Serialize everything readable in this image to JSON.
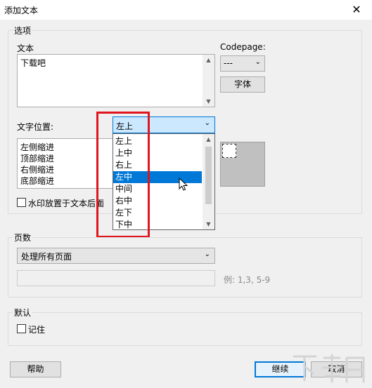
{
  "window": {
    "title": "添加文本"
  },
  "options_group": {
    "label": "选项",
    "text_label": "文本",
    "text_value": "下载吧",
    "codepage_label": "Codepage:",
    "codepage_value": "---",
    "font_button": "字体",
    "position_label": "文字位置:",
    "position_value": "左上",
    "position_options": [
      "左上",
      "上中",
      "右上",
      "左中",
      "中间",
      "右中",
      "左下",
      "下中"
    ],
    "position_highlighted": "左中",
    "indent_items": [
      "左侧缩进",
      "顶部缩进",
      "右侧缩进",
      "底部缩进"
    ],
    "watermark_behind_label": "水印放置于文本后面"
  },
  "pages_group": {
    "label": "页数",
    "mode_value": "处理所有页面",
    "range_hint": "例: 1,3, 5-9"
  },
  "default_group": {
    "label": "默认",
    "remember_label": "记住"
  },
  "buttons": {
    "help": "帮助",
    "continue": "继续",
    "cancel": "取消"
  },
  "colors": {
    "highlight": "#0078d7",
    "annotation_red": "#e0161e",
    "preview_gray": "#c0c0c0"
  }
}
